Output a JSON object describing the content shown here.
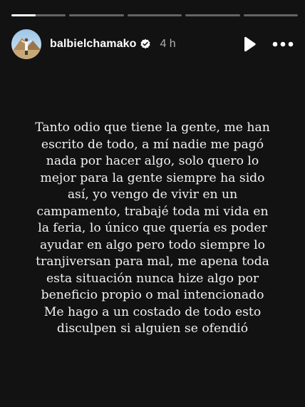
{
  "story": {
    "progress": {
      "segments": 5,
      "active_index": 0,
      "active_fraction": 0.45
    },
    "header": {
      "username": "balbielchamako",
      "time": "4 h",
      "avatar_icon": "profile-photo",
      "verified_icon": "verified-badge-icon",
      "play_icon": "play-icon",
      "more_icon": "more-icon"
    },
    "text": "Tanto odio que tiene la gente, me han\nescrito de todo, a mí nadie me pagó\nnada por hacer algo, solo quero lo\nmejor para la gente siempre ha sido\nasí, yo vengo de vivir en un\ncampamento, trabajé toda mi vida en\nla feria, lo único que quería es poder\nayudar en algo pero todo siempre lo\ntranjiversan para mal, me apena toda\nesta situación nunca hize algo por\nbeneficio propio o mal intencionado\nMe hago a un costado de todo esto\ndisculpen si alguien se ofendió"
  }
}
